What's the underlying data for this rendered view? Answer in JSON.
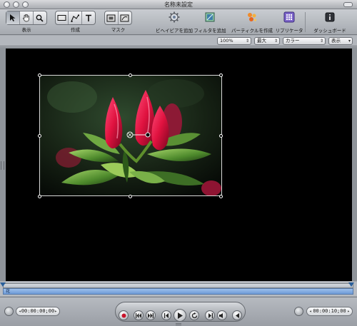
{
  "window": {
    "title": "名称未設定"
  },
  "toolbar": {
    "view_label": "表示",
    "create_label": "作成",
    "mask_label": "マスク",
    "behaviors_label": "ビヘイビアを追加",
    "filters_label": "フィルタを追加",
    "particles_label": "パーティクルを作成",
    "replicator_label": "リプリケータ",
    "dashboard_label": "ダッシュボード"
  },
  "options": {
    "zoom": "100%",
    "resolution": "最大",
    "color": "カラー",
    "view": "表示"
  },
  "timeline": {
    "track_label": "花"
  },
  "transport": {
    "current_timecode": "00:00:00;00",
    "duration_timecode": "00:00:10;00"
  },
  "colors": {
    "accent_track": "#7ea7dd",
    "record": "#c8122a"
  }
}
